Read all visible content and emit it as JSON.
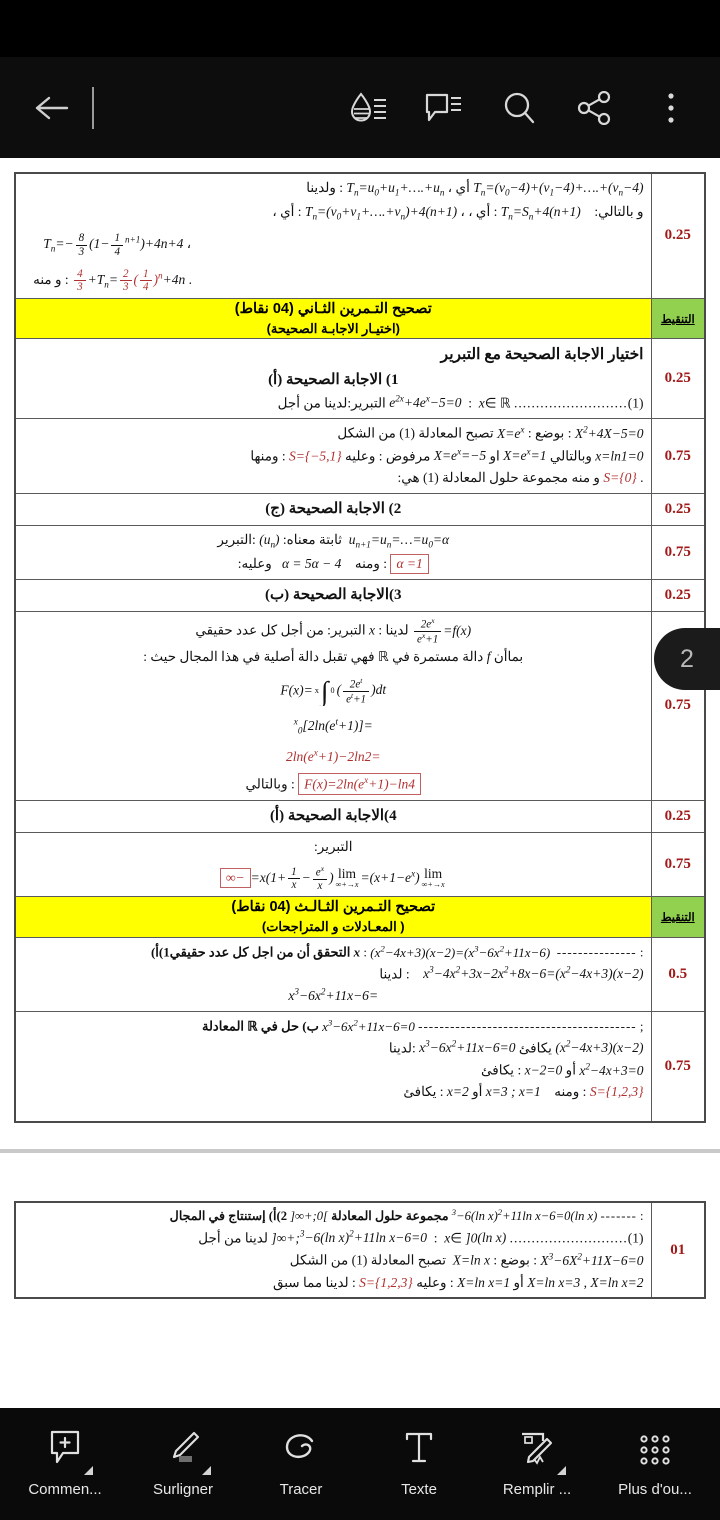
{
  "app": {
    "topbar": {
      "back_icon": "arrow-left-icon",
      "icons": [
        {
          "name": "highlight-drop-icon",
          "label": "Surlignage"
        },
        {
          "name": "comment-bubble-icon",
          "label": "Commentaires"
        },
        {
          "name": "search-icon",
          "label": "Rechercher"
        },
        {
          "name": "share-icon",
          "label": "Partager"
        },
        {
          "name": "overflow-menu-icon",
          "label": "Plus"
        }
      ]
    },
    "page_indicator": "2",
    "bottom_toolbar": [
      {
        "icon": "comment-add-icon",
        "label": "Commen...",
        "has_caret": true
      },
      {
        "icon": "highlighter-pen-icon",
        "label": "Surligner",
        "has_caret": true
      },
      {
        "icon": "draw-loop-icon",
        "label": "Tracer",
        "has_caret": false
      },
      {
        "icon": "text-tool-icon",
        "label": "Texte",
        "has_caret": false
      },
      {
        "icon": "fill-sign-icon",
        "label": "Remplir ...",
        "has_caret": true
      },
      {
        "icon": "grid-more-icon",
        "label": "Plus d'ou...",
        "has_caret": false
      }
    ]
  },
  "document": {
    "page1": {
      "row_ex1_tail": {
        "mark": "0.25",
        "lines": [
          "T<sub class=\"sub\">n</sub> = (v<sub class=\"sub\">0</sub> − 4) + (v<sub class=\"sub\">1</sub> − 4) + …. + (v<sub class=\"sub\">n</sub> − 4)  أي  ،  T<sub class=\"sub\">n</sub> = u<sub class=\"sub\">0</sub> + u<sub class=\"sub\">1</sub> + …. + u<sub class=\"sub\">n</sub>  : ولدينا",
          "T<sub class=\"sub\">n</sub> = S<sub class=\"sub\">n</sub> + 4(n+1)  : أي  ،  ،  T<sub class=\"sub\">n</sub> = (v<sub class=\"sub\">0</sub> + v<sub class=\"sub\">1</sub> + …. + v<sub class=\"sub\">n</sub>) + 4(n+1)  : أي  ،   و بالتالي:",
          "، T<sub class=\"sub\">n</sub> = − 8/3 ( 1 − (1/4)^(n+1) ) + 4n + 4",
          ". T<sub class=\"sub\">n</sub> = 2/3 (1/4)^n + 4n + 4/3  : و منه"
        ]
      },
      "banner_ex2": {
        "mark_label": "التنقيط",
        "title": "تصحيح  التـمرين  الثـاني  (04 نقاط)",
        "subtitle": "(اختيـار  الاجابـة  الصحيحة)"
      },
      "ex2_intro": "اختيار الاجابة الصحيحة مع التبرير",
      "ex2_items": [
        {
          "heading": "1)  الاجابة الصحيحة (أ)",
          "marks": [
            "0.25",
            "0.75"
          ],
          "lines": [
            "التبرير:لدينا من أجل x ∈ ℝ  :  e^2x + 4e^x − 5 = 0 ........................(1)",
            "بوضع : X = e^x   تصبح المعادلة (1) من الشكل : X² + 4X − 5 = 0",
            "ومنها : S = {−5,1}  وعليه : مرفوض X = e^x = −5 او X = e^x = 1 وبالتالي x = ln1 = 0",
            "و منه مجموعة حلول المعادلة (1) هي: S = {0} ."
          ]
        },
        {
          "heading": "2)  الاجابة الصحيحة (ج)",
          "marks": [
            "0.25",
            "0.75"
          ],
          "lines": [
            "التبرير: (u<sub class=\"sub\">n</sub>) ثابتة معناه: u<sub class=\"sub\">n+1</sub> = u<sub class=\"sub\">n</sub> = … = u<sub class=\"sub\">0</sub> = α",
            "وعليه: α = 5α − 4     ومنه :  α = 1"
          ]
        },
        {
          "heading": "3)الاجابة الصحيحة (ب)",
          "marks": [
            "0.25",
            "0.75"
          ],
          "lines": [
            "التبرير: من أجل كل عدد حقيقي x : لدينا  f(x) = 2e^x/(e^x+1)",
            "بماأن f دالة مستمرة في ℝ فهي تقبل دالة أصلية في هذا المجال حيث :",
            "F(x) = ∫ от 0 до x ( 2e^t/(e^t+1) ) dt",
            "= [ 2ln(e^t + 1) ] от 0 до x",
            "= 2ln(e^x + 1) − 2ln 2",
            "وبالتالي :  F(x) = 2ln(e^x + 1) − ln 4"
          ]
        },
        {
          "heading": "4)الاجابة الصحيحة (أ)",
          "marks": [
            "0.25",
            "0.75"
          ],
          "lines": [
            "التبرير:",
            "lim(x→+∞) (x + 1 − e^x) = lim(x→+∞) x ( 1 + 1/x − e^x/x ) = −∞"
          ]
        }
      ],
      "banner_ex3": {
        "mark_label": "التنقيط",
        "title": "تصحيح  التـمرين  الثـالـث  (04 نقاط)",
        "subtitle": "( المعـادلات  و المتراجحات)"
      },
      "ex3_items": [
        {
          "mark": "0.5",
          "lines": [
            "1)أ)التحقق أن من اجل كل عدد حقيقي x : (x³ − 6x² + 11x − 6) = (x − 2)(x² − 4x + 3) : --------------",
            "لدينا : (x − 2)(x² − 4x + 3) = x³ − 4x² + 3x − 2x² + 8x − 6",
            "= x³ − 6x² + 11x − 6"
          ]
        },
        {
          "mark": "0.75",
          "lines": [
            "ب) حل في ℝ المعادلة : x³ − 6x² + 11x − 6 = 0 ; -------------------------------------------",
            "لدينا: x³ − 6x² + 11x − 6 = 0 يكافئ (x − 2)(x² − 4x + 3)",
            "يكافئ : x − 2 = 0 أو x² − 4x + 3 = 0",
            "يكافئ : x = 2 أو x = 1 ; x = 3     ومنه : S = {1,2,3}"
          ]
        }
      ]
    },
    "page2": {
      "row": {
        "mark": "01",
        "lines": [
          "2)أ) إستنتاج في المجال ]0;+∞[ مجموعة حلول المعادلة (ln x)³ − 6(ln x)² + 11ln x − 6 = 0 : -------",
          "لدينا من أجل x ∈ ]0;+∞[  :  (ln x)³ − 6(ln x)² + 11ln x − 6 = 0 ............................(1)",
          "بوضع : X = ln x   تصبح المعادلة (1) من الشكل : X³ − 6X² + 11X − 6 = 0",
          "لدينا مما سبق : S = {1,2,3} وعليه : X = ln x = 1 أو X = ln x = 2 , X = ln x = 3"
        ]
      }
    }
  },
  "colors": {
    "banner_yellow": "#ffff00",
    "banner_green": "#92d14f",
    "mark_red": "#a01a1a",
    "accent_red": "#b03030",
    "toolbar_bg": "#0a0a0a"
  }
}
